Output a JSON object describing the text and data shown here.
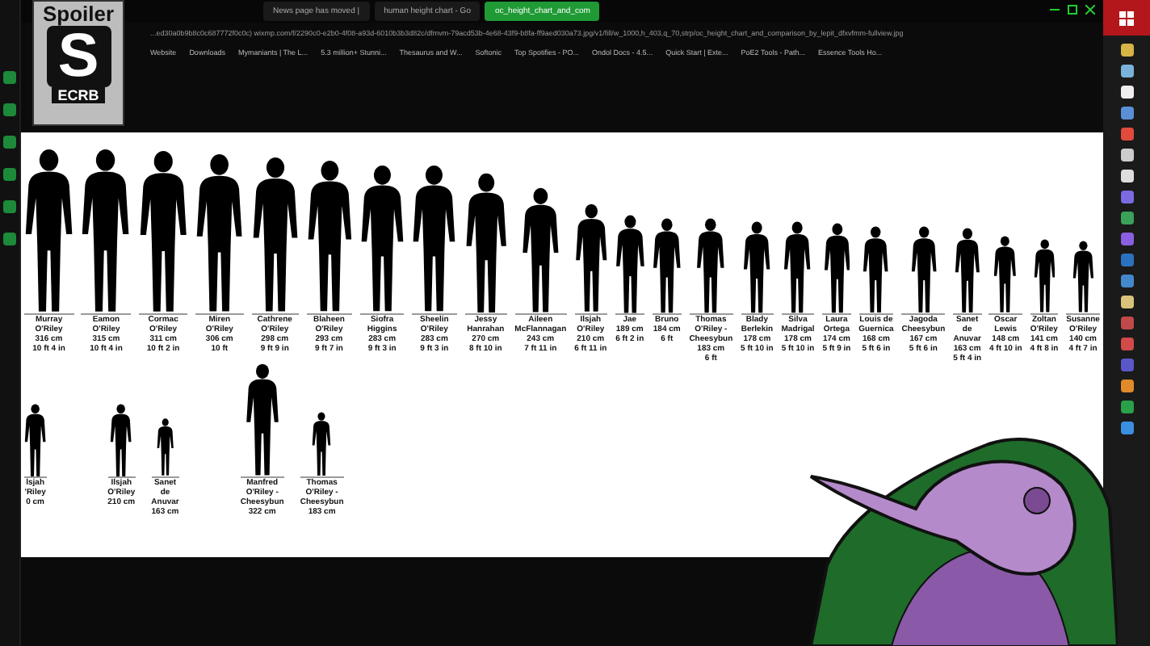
{
  "browser": {
    "tabs": [
      {
        "label": "News page has moved |",
        "selected": false
      },
      {
        "label": "human height chart - Go",
        "selected": false
      },
      {
        "label": "oc_height_chart_and_com",
        "selected": true
      }
    ],
    "url": "...ed30a0b9b8c0c687772f0c0c) wixmp.com/f/2290c0-e2b0-4f08-a93d-6010b3b3d82c/dfmvm-79acd53b-4e68-43f9-b8fa-ff9aed030a73.jpg/v1/fill/w_1000,h_403,q_70,strp/oc_height_chart_and_comparison_by_lepit_dfxvfmm-fullview.jpg",
    "bookmarks": [
      "Website",
      "Downloads",
      "Mymaniants | The L...",
      "5.3 million+ Stunni...",
      "Thesaurus and W...",
      "Softonic",
      "Top Spotifies - PO...",
      "Ondol Docs - 4.5...",
      "Quick Start | Exte...",
      "PoE2 Tools - Path...",
      "Essence Tools Ho..."
    ]
  },
  "overlay": {
    "title": "Spoiler",
    "logo": "S",
    "caption": "ECRB"
  },
  "chart": {
    "rows": [
      {
        "figures": [
          {
            "name": "Murray O'Riley",
            "cm": "316 cm",
            "ft": "10 ft 4 in",
            "level": 0.98
          },
          {
            "name": "Eamon O'Riley",
            "cm": "315 cm",
            "ft": "10 ft 4 in",
            "level": 0.98
          },
          {
            "name": "Cormac O'Riley",
            "cm": "311 cm",
            "ft": "10 ft 2 in",
            "level": 0.97
          },
          {
            "name": "Miren O'Riley",
            "cm": "306 cm",
            "ft": "10 ft",
            "level": 0.95
          },
          {
            "name": "Cathrene O'Riley",
            "cm": "298 cm",
            "ft": "9 ft 9 in",
            "level": 0.93
          },
          {
            "name": "Blaheen O'Riley",
            "cm": "293 cm",
            "ft": "9 ft 7 in",
            "level": 0.91
          },
          {
            "name": "Siofra Higgins",
            "cm": "283 cm",
            "ft": "9 ft 3 in",
            "level": 0.88
          },
          {
            "name": "Sheelin O'Riley",
            "cm": "283 cm",
            "ft": "9 ft 3 in",
            "level": 0.88
          },
          {
            "name": "Jessy Hanrahan",
            "cm": "270 cm",
            "ft": "8 ft 10 in",
            "level": 0.84
          },
          {
            "name": "Aileen McFlannagan",
            "cm": "243 cm",
            "ft": "7 ft 11 in",
            "level": 0.75
          },
          {
            "name": "Ilsjah O'Riley",
            "cm": "210 cm",
            "ft": "6 ft 11 in",
            "level": 0.65
          },
          {
            "name": "Jae",
            "cm": "189 cm",
            "ft": "6 ft 2 in",
            "level": 0.59
          },
          {
            "name": "Bruno",
            "cm": "184 cm",
            "ft": "6 ft",
            "level": 0.57
          },
          {
            "name": "Thomas O'Riley - Cheesybun",
            "cm": "183 cm",
            "ft": "6 ft",
            "level": 0.57
          },
          {
            "name": "Blady Berlekin",
            "cm": "178 cm",
            "ft": "5 ft 10 in",
            "level": 0.55
          },
          {
            "name": "Silva Madrigal",
            "cm": "178 cm",
            "ft": "5 ft 10 in",
            "level": 0.55
          },
          {
            "name": "Laura Ortega",
            "cm": "174 cm",
            "ft": "5 ft 9 in",
            "level": 0.54
          },
          {
            "name": "Louis de Guernica",
            "cm": "168 cm",
            "ft": "5 ft 6 in",
            "level": 0.52
          },
          {
            "name": "Jagoda Cheesybun",
            "cm": "167 cm",
            "ft": "5 ft 6 in",
            "level": 0.52
          },
          {
            "name": "Sanet de Anuvar",
            "cm": "163 cm",
            "ft": "5 ft 4 in",
            "level": 0.51
          },
          {
            "name": "Oscar Lewis",
            "cm": "148 cm",
            "ft": "4 ft 10 in",
            "level": 0.46
          },
          {
            "name": "Zoltan O'Riley",
            "cm": "141 cm",
            "ft": "4 ft 8 in",
            "level": 0.44
          },
          {
            "name": "Susanne O'Riley",
            "cm": "140 cm",
            "ft": "4 ft 7 in",
            "level": 0.43
          }
        ]
      },
      {
        "figures": [
          {
            "name": "lsjah 'Riley",
            "cm": "0 cm",
            "level": 0.65
          },
          {
            "name": "Ilsjah O'Riley",
            "cm": "210 cm",
            "level": 0.65
          },
          {
            "name": "Sanet de Anuvar",
            "cm": "163 cm",
            "level": 0.51
          },
          {
            "name": "Manfred O'Riley - Cheesybun",
            "cm": "322 cm",
            "level": 1
          },
          {
            "name": "Thomas O'Riley - Cheesybun",
            "cm": "183 cm",
            "level": 0.57
          }
        ]
      }
    ]
  }
}
